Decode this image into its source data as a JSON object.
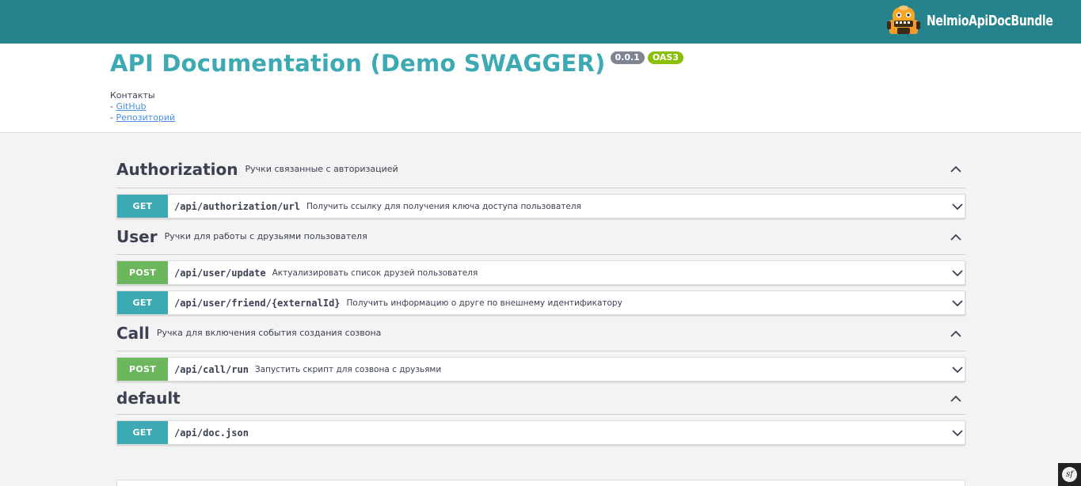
{
  "topbar": {
    "brand": "NelmioApiDocBundle"
  },
  "info": {
    "title": "API Documentation (Demo SWAGGER)",
    "version": "0.0.1",
    "oas": "OAS3",
    "contacts_label": "Контакты",
    "links": [
      {
        "prefix": "- ",
        "label": "GitHub"
      },
      {
        "prefix": "- ",
        "label": "Репозиторий"
      }
    ]
  },
  "tags": [
    {
      "name": "Authorization",
      "description": "Ручки связанные с авторизацией",
      "operations": [
        {
          "method": "GET",
          "path": "/api/authorization/url",
          "summary": "Получить ссылку для получения ключа доступа пользователя"
        }
      ]
    },
    {
      "name": "User",
      "description": "Ручки для работы с друзьями пользователя",
      "operations": [
        {
          "method": "POST",
          "path": "/api/user/update",
          "summary": "Актуализировать список друзей пользователя"
        },
        {
          "method": "GET",
          "path": "/api/user/friend/{externalId}",
          "summary": "Получить информацию о друге по внешнему идентификатору"
        }
      ]
    },
    {
      "name": "Call",
      "description": "Ручка для включения события создания созвона",
      "operations": [
        {
          "method": "POST",
          "path": "/api/call/run",
          "summary": "Запустить скрипт для созвона с друзьями"
        }
      ]
    },
    {
      "name": "default",
      "description": "",
      "operations": [
        {
          "method": "GET",
          "path": "/api/doc.json",
          "summary": ""
        }
      ]
    }
  ],
  "colors": {
    "topbar": "#25838e",
    "title": "#3ca9b3",
    "get": "#3ca9b3",
    "post": "#6cb65e",
    "version_badge": "#7d8492",
    "oas_badge": "#89bf04"
  },
  "icons": {
    "logo": "nelmio-robot-logo",
    "collapse": "chevron-up-icon",
    "expand": "chevron-down-icon",
    "toolbar": "symfony-icon"
  },
  "sf_toolbar": {
    "label": "sf"
  }
}
